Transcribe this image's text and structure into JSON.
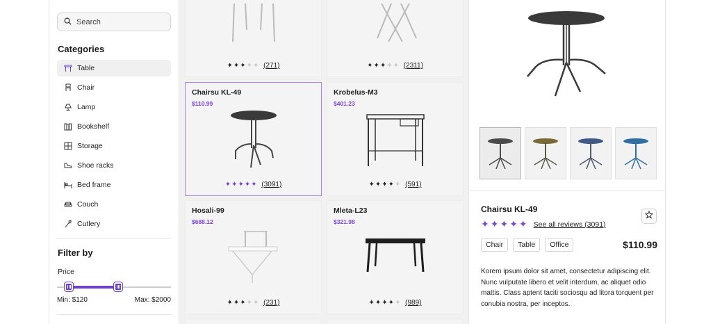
{
  "search": {
    "placeholder": "Search"
  },
  "categories": {
    "title": "Categories",
    "items": [
      {
        "label": "Table",
        "icon": "table-icon"
      },
      {
        "label": "Chair",
        "icon": "chair-icon"
      },
      {
        "label": "Lamp",
        "icon": "lamp-icon"
      },
      {
        "label": "Bookshelf",
        "icon": "bookshelf-icon"
      },
      {
        "label": "Storage",
        "icon": "storage-icon"
      },
      {
        "label": "Shoe racks",
        "icon": "shoe-rack-icon"
      },
      {
        "label": "Bed frame",
        "icon": "bed-frame-icon"
      },
      {
        "label": "Couch",
        "icon": "couch-icon"
      },
      {
        "label": "Cutlery",
        "icon": "cutlery-icon"
      }
    ]
  },
  "filter": {
    "title": "Filter by",
    "price_label": "Price",
    "min_label": "Min: $120",
    "max_label": "Max: $2000"
  },
  "products": [
    {
      "name": "",
      "price": "",
      "rating": 3,
      "reviews": "(271)"
    },
    {
      "name": "",
      "price": "",
      "rating": 3,
      "reviews": "(2311)"
    },
    {
      "name": "Chairsu KL-49",
      "price": "$110.99",
      "rating": 5,
      "reviews": "(3091)"
    },
    {
      "name": "Krobelus-M3",
      "price": "$401.23",
      "rating": 4,
      "reviews": "(591)"
    },
    {
      "name": "Hosali-99",
      "price": "$688.12",
      "rating": 3,
      "reviews": "(231)"
    },
    {
      "name": "Mleta-L23",
      "price": "$321.98",
      "rating": 4,
      "reviews": "(989)"
    }
  ],
  "detail": {
    "name": "Chairsu KL-49",
    "reviews_link": "See all reviews (3091)",
    "rating": 5,
    "tags": [
      "Chair",
      "Table",
      "Office"
    ],
    "price": "$110.99",
    "description": "Korem ipsum dolor sit amet, consectetur adipiscing elit. Nunc vulputate libero et velit interdum, ac aliquet odio mattis. Class aptent taciti sociosqu ad litora torquent per conubia nostra, per inceptos.",
    "thumbnail_colors": [
      "#4a4a4a",
      "#7a6a36",
      "#3e5a86",
      "#2f6fa6"
    ]
  },
  "colors": {
    "accent": "#6d3fd0"
  }
}
